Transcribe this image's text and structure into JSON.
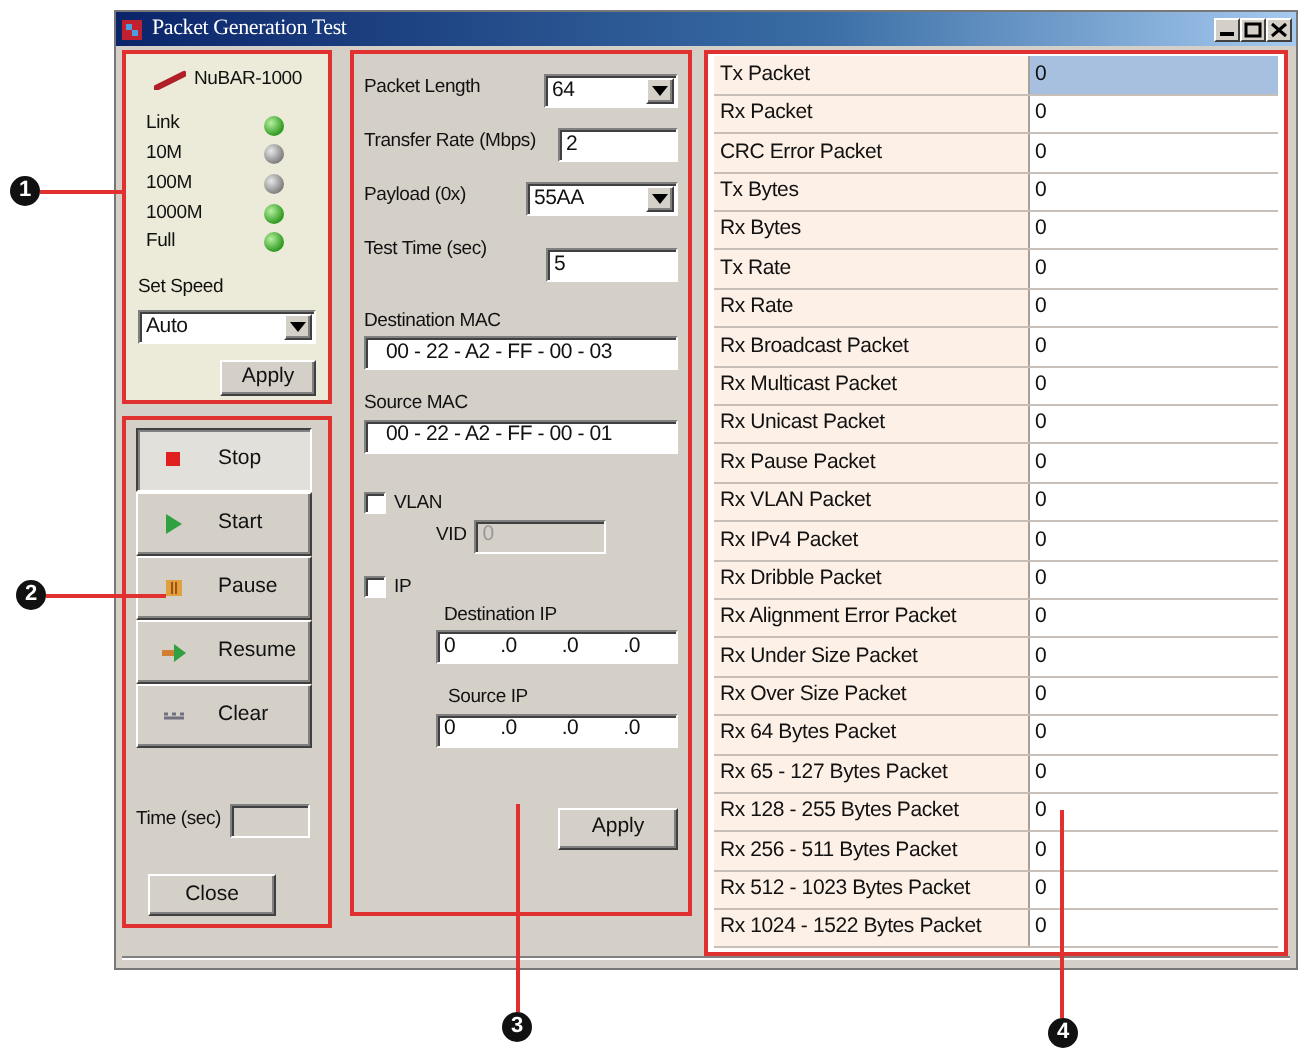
{
  "window": {
    "title": "Packet Generation Test"
  },
  "device": {
    "name": "NuBAR-1000",
    "indicators": [
      {
        "label": "Link",
        "on": true
      },
      {
        "label": "10M",
        "on": false
      },
      {
        "label": "100M",
        "on": false
      },
      {
        "label": "1000M",
        "on": true
      },
      {
        "label": "Full",
        "on": true
      }
    ],
    "speed_label": "Set Speed",
    "speed_value": "Auto",
    "apply": "Apply"
  },
  "controls": {
    "buttons": [
      {
        "label": "Stop",
        "pressed": true
      },
      {
        "label": "Start",
        "pressed": false
      },
      {
        "label": "Pause",
        "pressed": false
      },
      {
        "label": "Resume",
        "pressed": false
      },
      {
        "label": "Clear",
        "pressed": false
      }
    ],
    "time_label": "Time (sec)",
    "close": "Close"
  },
  "settings": {
    "fields": [
      {
        "label": "Packet Length",
        "kind": "select",
        "value": "64"
      },
      {
        "label": "Transfer Rate (Mbps)",
        "kind": "input",
        "value": "2"
      },
      {
        "label": "Payload (0x)",
        "kind": "select",
        "value": "55AA"
      },
      {
        "label": "Test Time (sec)",
        "kind": "input",
        "value": "5"
      }
    ],
    "destination_mac": {
      "label": "Destination MAC",
      "value": "00 - 22 - A2 - FF - 00 - 03"
    },
    "source_mac": {
      "label": "Source MAC",
      "value": "00 - 22 - A2 - FF - 00 - 01"
    },
    "vlan": {
      "label": "VLAN",
      "checked": false,
      "vid_label": "VID",
      "vid_value": "0"
    },
    "ip": {
      "label": "IP",
      "checked": false,
      "destination": {
        "label": "Destination IP",
        "parts": [
          "0",
          ".0",
          ".0",
          ".0"
        ]
      },
      "source": {
        "label": "Source IP",
        "parts": [
          "0",
          ".0",
          ".0",
          ".0"
        ]
      }
    },
    "apply": "Apply"
  },
  "stats": {
    "rows": [
      {
        "name": "Tx Packet",
        "value": "0",
        "selected": true
      },
      {
        "name": "Rx Packet",
        "value": "0",
        "selected": false
      },
      {
        "name": "CRC Error Packet",
        "value": "0",
        "selected": false
      },
      {
        "name": "Tx Bytes",
        "value": "0",
        "selected": false
      },
      {
        "name": "Rx Bytes",
        "value": "0",
        "selected": false
      },
      {
        "name": "Tx Rate",
        "value": "0",
        "selected": false
      },
      {
        "name": "Rx Rate",
        "value": "0",
        "selected": false
      },
      {
        "name": "Rx Broadcast Packet",
        "value": "0",
        "selected": false
      },
      {
        "name": "Rx Multicast Packet",
        "value": "0",
        "selected": false
      },
      {
        "name": "Rx Unicast Packet",
        "value": "0",
        "selected": false
      },
      {
        "name": "Rx Pause Packet",
        "value": "0",
        "selected": false
      },
      {
        "name": "Rx VLAN Packet",
        "value": "0",
        "selected": false
      },
      {
        "name": "Rx IPv4 Packet",
        "value": "0",
        "selected": false
      },
      {
        "name": "Rx Dribble Packet",
        "value": "0",
        "selected": false
      },
      {
        "name": "Rx Alignment Error Packet",
        "value": "0",
        "selected": false
      },
      {
        "name": "Rx Under Size Packet",
        "value": "0",
        "selected": false
      },
      {
        "name": "Rx Over Size Packet",
        "value": "0",
        "selected": false
      },
      {
        "name": "Rx 64 Bytes Packet",
        "value": "0",
        "selected": false
      },
      {
        "name": "Rx 65 - 127 Bytes Packet",
        "value": "0",
        "selected": false
      },
      {
        "name": "Rx 128 - 255 Bytes Packet",
        "value": "0",
        "selected": false
      },
      {
        "name": "Rx 256 - 511 Bytes Packet",
        "value": "0",
        "selected": false
      },
      {
        "name": "Rx 512 - 1023 Bytes Packet",
        "value": "0",
        "selected": false
      },
      {
        "name": "Rx 1024 - 1522 Bytes Packet",
        "value": "0",
        "selected": false
      }
    ]
  },
  "callouts": [
    {
      "number": "1"
    },
    {
      "number": "2"
    },
    {
      "number": "3"
    },
    {
      "number": "4"
    }
  ]
}
